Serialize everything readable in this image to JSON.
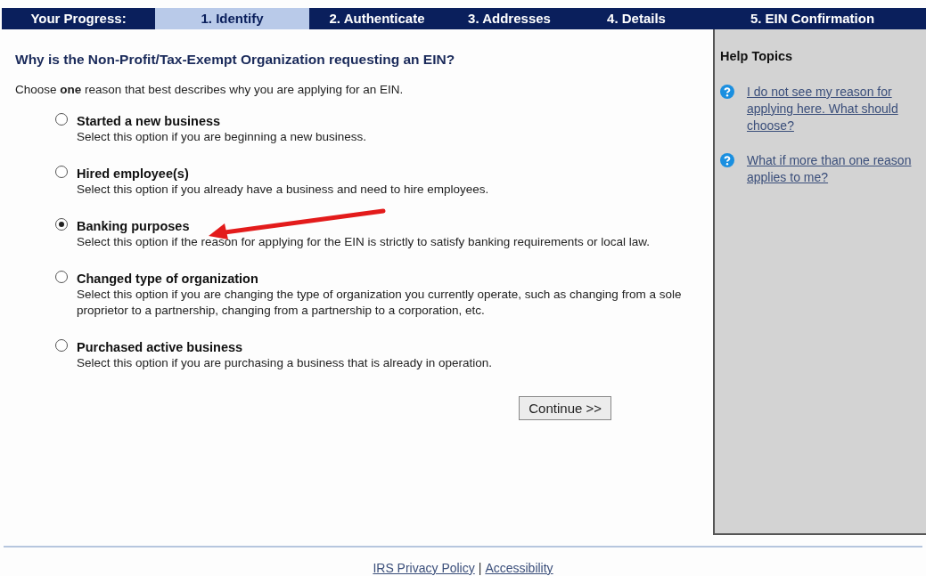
{
  "progress": {
    "label": "Your Progress:",
    "steps": [
      {
        "label": "1. Identify",
        "selected": true
      },
      {
        "label": "2. Authenticate",
        "selected": false
      },
      {
        "label": "3. Addresses",
        "selected": false
      },
      {
        "label": "4. Details",
        "selected": false
      },
      {
        "label": "5. EIN Confirmation",
        "selected": false
      }
    ]
  },
  "question": "Why is the Non-Profit/Tax-Exempt Organization requesting an EIN?",
  "instruction": "Choose **one** reason that best describes why you are applying for an EIN.",
  "options": [
    {
      "title": "Started a new business",
      "description": "Select this option if you are beginning a new business.",
      "selected": false
    },
    {
      "title": "Hired employee(s)",
      "description": "Select this option if you already have a business and need to hire employees.",
      "selected": false
    },
    {
      "title": "Banking purposes",
      "description": "Select this option if the reason for applying for the EIN is strictly to satisfy banking requirements or local law.",
      "selected": true
    },
    {
      "title": "Changed type of organization",
      "description": "Select this option if you are changing the type of organization you currently operate, such as changing from a sole proprietor to a partnership, changing from a partnership to a corporation, etc.",
      "selected": false
    },
    {
      "title": "Purchased active business",
      "description": "Select this option if you are purchasing a business that is already in operation.",
      "selected": false
    }
  ],
  "continue_button": "Continue >>",
  "help": {
    "title": "Help Topics",
    "links": [
      "I do not see my reason for applying here. What should choose?",
      "What if more than one reason applies to me?"
    ]
  },
  "footer": {
    "links": [
      "IRS Privacy Policy",
      "Accessibility"
    ],
    "separator": "|"
  }
}
